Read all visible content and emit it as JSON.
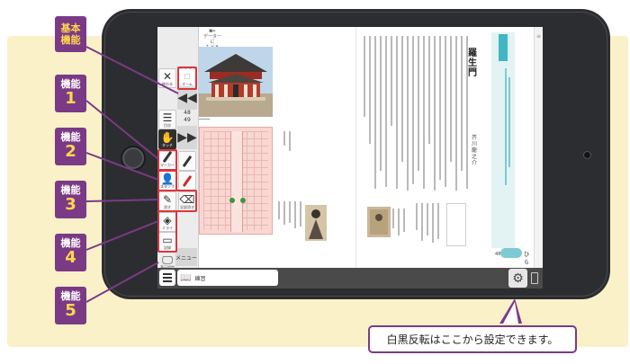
{
  "callouts": {
    "basic": "基本\n機能",
    "items": [
      {
        "cap": "機能",
        "num": "1"
      },
      {
        "cap": "機能",
        "num": "2"
      },
      {
        "cap": "機能",
        "num": "3"
      },
      {
        "cap": "機能",
        "num": "4"
      },
      {
        "cap": "機能",
        "num": "5"
      }
    ]
  },
  "toolbar": {
    "close": "終わる",
    "select": "ズーム",
    "index": "目次",
    "touch": "タッチ",
    "marker": "マーカー",
    "stamp": "スタンプ",
    "eraser": "消す",
    "eraser_all": "全部消す",
    "view": "ミライ",
    "register": "記録",
    "display_settings": "表示設定",
    "menu": "メニュー",
    "page_top": "48",
    "page_bottom": "49"
  },
  "reader": {
    "back_label": "データーに\nもどる",
    "book_title": "練習",
    "story_title": "羅生門",
    "author": "芥川龍之介",
    "page_number": "48",
    "open_label": "ひらく"
  },
  "bubble_text": "白黒反転はここから設定できます。",
  "icons": {
    "close": "close-icon",
    "zoom": "zoom-icon",
    "index": "list-icon",
    "touch": "hand-icon",
    "pen": "pen-icon",
    "settings": "gear-icon",
    "book": "book-icon",
    "menu": "hamburger-icon"
  },
  "colors": {
    "accent_purple": "#7b3a86",
    "callout_number": "#ffd84a",
    "highlight_red": "#d9363e",
    "title_teal": "#41b6c4",
    "background_cream": "#fbf1c9"
  }
}
